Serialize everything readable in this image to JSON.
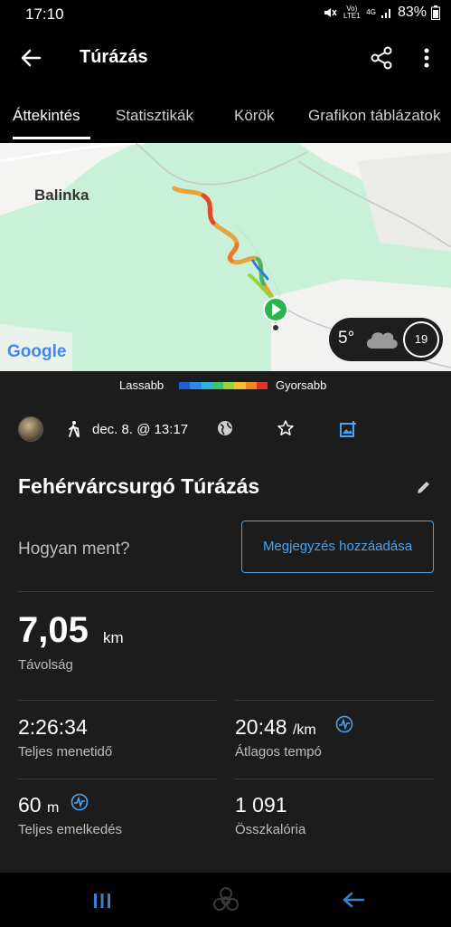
{
  "status_bar": {
    "time": "17:10",
    "signal_labels": "Vo) LTE1",
    "network": "4G",
    "battery": "83%"
  },
  "app_bar": {
    "title": "Túrázás",
    "back_icon": "arrow-left-icon",
    "share_icon": "share-icon",
    "more_icon": "more-vertical-icon"
  },
  "tabs": [
    {
      "label": "Áttekintés",
      "active": true
    },
    {
      "label": "Statisztikák",
      "active": false
    },
    {
      "label": "Körök",
      "active": false
    },
    {
      "label": "Grafikon táblázatok",
      "active": false
    }
  ],
  "map": {
    "place_label": "Balinka",
    "provider": "Google",
    "weather": {
      "temperature": "5°",
      "icon": "cloud-icon",
      "wind": "19"
    }
  },
  "legend": {
    "slow_label": "Lassabb",
    "fast_label": "Gyorsabb",
    "colors": [
      "#1f5fd6",
      "#2b8ae6",
      "#2bb6d9",
      "#3cc46a",
      "#9bd236",
      "#f2c12e",
      "#f28a1e",
      "#e0332b"
    ]
  },
  "activity": {
    "date": "dec. 8. @ 13:17",
    "name": "Fehérvárcsurgó Túrázás",
    "how_question": "Hogyan ment?",
    "add_note_label": "Megjegyzés hozzáadása"
  },
  "stats": {
    "distance": {
      "value": "7,05",
      "unit": "km",
      "label": "Távolság"
    },
    "total_time": {
      "value": "2:26:34",
      "label": "Teljes menetidő"
    },
    "avg_pace": {
      "value": "20:48",
      "unit": "/km",
      "label": "Átlagos tempó"
    },
    "elevation": {
      "value": "60",
      "unit": "m",
      "label": "Teljes emelkedés"
    },
    "calories": {
      "value": "1 091",
      "label": "Összkalória"
    }
  },
  "colors": {
    "accent": "#4aa3f0",
    "card_bg": "#1c1c1c",
    "map_green": "#c8f0d8"
  }
}
